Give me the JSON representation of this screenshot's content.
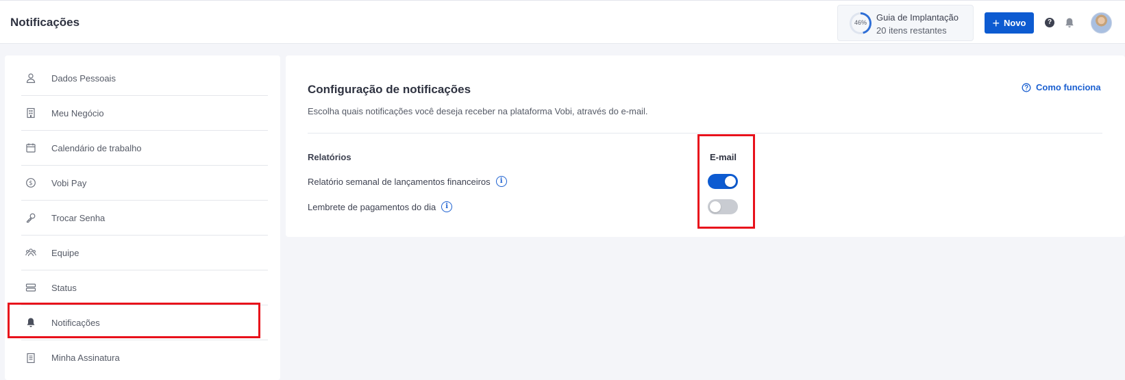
{
  "header": {
    "title": "Notificações",
    "guide": {
      "percent": "46%",
      "title": "Guia de Implantação",
      "subtitle": "20 itens restantes",
      "progress": 0.46
    },
    "new_button": "Novo",
    "icons": [
      "help-icon",
      "bell-icon",
      "avatar"
    ]
  },
  "sidebar": {
    "items": [
      {
        "label": "Dados Pessoais",
        "icon": "user-icon"
      },
      {
        "label": "Meu Negócio",
        "icon": "building-icon"
      },
      {
        "label": "Calendário de trabalho",
        "icon": "calendar-icon"
      },
      {
        "label": "Vobi Pay",
        "icon": "dollar-circle-icon"
      },
      {
        "label": "Trocar Senha",
        "icon": "key-icon"
      },
      {
        "label": "Equipe",
        "icon": "team-icon"
      },
      {
        "label": "Status",
        "icon": "status-icon"
      },
      {
        "label": "Notificações",
        "icon": "bell-icon",
        "active": true
      },
      {
        "label": "Minha Assinatura",
        "icon": "receipt-icon"
      }
    ]
  },
  "main": {
    "title": "Configuração de notificações",
    "description": "Escolha quais notificações você deseja receber na plataforma Vobi, através do e-mail.",
    "how_link": "Como funciona",
    "section_label": "Relatórios",
    "column_label": "E-mail",
    "rows": [
      {
        "label": "Relatório semanal de lançamentos financeiros",
        "email_enabled": true
      },
      {
        "label": "Lembrete de pagamentos do dia",
        "email_enabled": false
      }
    ]
  },
  "colors": {
    "accent": "#0d5bd1",
    "highlight": "#e8111b",
    "toggle_off": "#c9ccd2"
  }
}
